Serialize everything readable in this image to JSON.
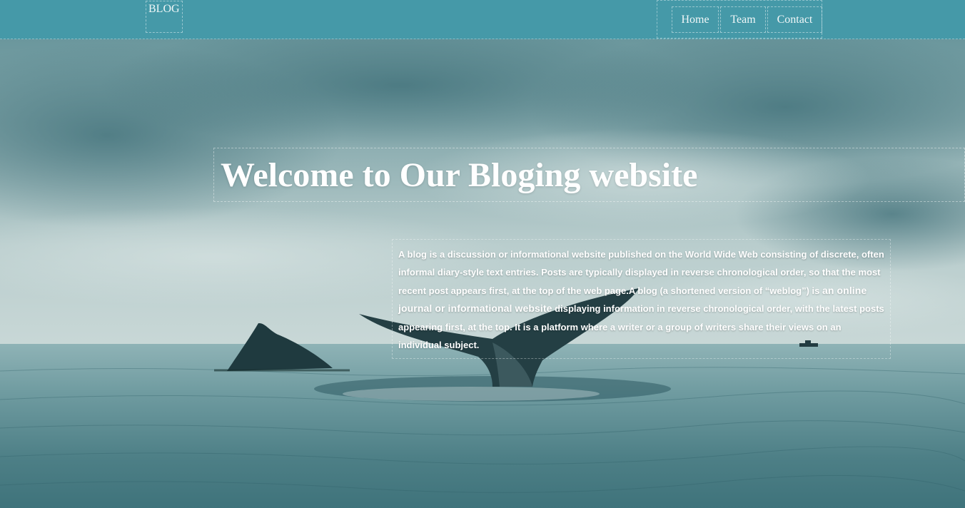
{
  "header": {
    "logo_text": "BLOG",
    "nav": [
      {
        "label": "Home"
      },
      {
        "label": "Team"
      },
      {
        "label": "Contact"
      }
    ]
  },
  "hero": {
    "title": "Welcome to Our Bloging website",
    "description": {
      "part1": "A blog is a discussion or informational website published on the World Wide Web consisting of discrete, often informal diary-style text entries. Posts are typically displayed in reverse chronological order, so that the most recent post appears first, at the top of the web page.A blog (a shortened version of “weblog”) is ",
      "emphasis": "an online journal or informational website",
      "part2": " displaying information in reverse chronological order, with the latest posts appearing first, at the top. It is a platform where a writer or a group of writers share their views on an individual subject."
    }
  },
  "colors": {
    "header_bg": "#4599a8",
    "text": "#ffffff"
  },
  "background": {
    "subject": "ocean with whale tail and fin under cloudy sky"
  }
}
